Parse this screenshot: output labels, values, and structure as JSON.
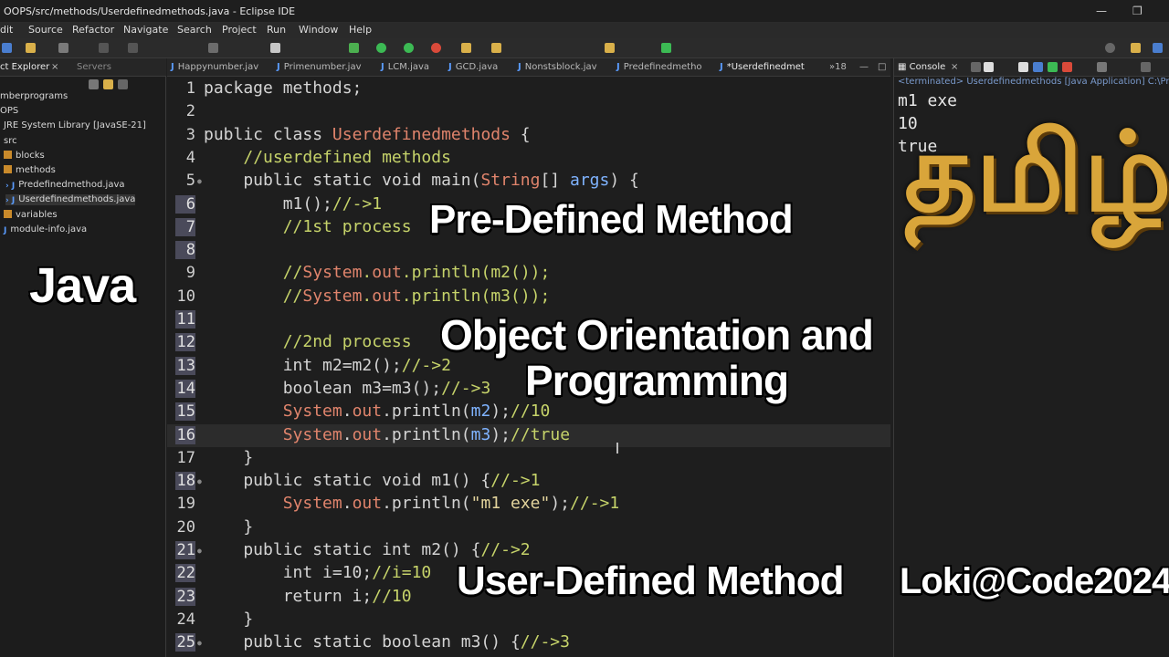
{
  "window": {
    "title": "OOPS/src/methods/Userdefinedmethods.java - Eclipse IDE"
  },
  "menu": [
    "dit",
    "Source",
    "Refactor",
    "Navigate",
    "Search",
    "Project",
    "Run",
    "Window",
    "Help"
  ],
  "explorer": {
    "tabs": [
      "ct Explorer",
      "Servers"
    ],
    "items": [
      {
        "label": "mberprograms"
      },
      {
        "label": "OPS"
      },
      {
        "label": "JRE System Library [JavaSE-21]"
      },
      {
        "label": "src"
      },
      {
        "label": "blocks"
      },
      {
        "label": "methods"
      },
      {
        "label": "Predefinedmethod.java"
      },
      {
        "label": "Userdefinedmethods.java"
      },
      {
        "label": "variables"
      },
      {
        "label": "module-info.java"
      }
    ]
  },
  "editor": {
    "tabs": [
      "Happynumber.jav",
      "Primenumber.jav",
      "LCM.java",
      "GCD.java",
      "Nonstsblock.jav",
      "Predefinedmetho",
      "*Userdefinedmet",
      "»18"
    ],
    "lines": [
      {
        "n": "1",
        "t": "package methods;"
      },
      {
        "n": "2",
        "t": ""
      },
      {
        "n": "3",
        "t": "public class Userdefinedmethods {"
      },
      {
        "n": "4",
        "t": "    //userdefined methods"
      },
      {
        "n": "5",
        "t": "    public static void main(String[] args) {"
      },
      {
        "n": "6",
        "t": "        m1();//->1"
      },
      {
        "n": "7",
        "t": "        //1st process"
      },
      {
        "n": "8",
        "t": ""
      },
      {
        "n": "9",
        "t": "        //System.out.println(m2());"
      },
      {
        "n": "10",
        "t": "        //System.out.println(m3());"
      },
      {
        "n": "11",
        "t": ""
      },
      {
        "n": "12",
        "t": "        //2nd process"
      },
      {
        "n": "13",
        "t": "        int m2=m2();//->2"
      },
      {
        "n": "14",
        "t": "        boolean m3=m3();//->3"
      },
      {
        "n": "15",
        "t": "        System.out.println(m2);//10"
      },
      {
        "n": "16",
        "t": "        System.out.println(m3);//true"
      },
      {
        "n": "17",
        "t": "    }"
      },
      {
        "n": "18",
        "t": "    public static void m1() {//->1"
      },
      {
        "n": "19",
        "t": "        System.out.println(\"m1 exe\");//->1"
      },
      {
        "n": "20",
        "t": "    }"
      },
      {
        "n": "21",
        "t": "    public static int m2() {//->2"
      },
      {
        "n": "22",
        "t": "        int i=10;//i=10"
      },
      {
        "n": "23",
        "t": "        return i;//10"
      },
      {
        "n": "24",
        "t": "    }"
      },
      {
        "n": "25",
        "t": "    public static boolean m3() {//->3"
      }
    ]
  },
  "console": {
    "tab": "Console",
    "terminated": "<terminated> Userdefinedmethods [Java Application] C:\\Progra",
    "output": [
      "m1 exe",
      "10",
      "true"
    ]
  },
  "overlays": {
    "predefined": "Pre-Defined Method",
    "oop1": "Object Orientation and",
    "oop2": "Programming",
    "userdefined": "User-Defined Method",
    "java": "Java",
    "tamil": "தமிழ்",
    "brand": "Loki@Code2024"
  }
}
